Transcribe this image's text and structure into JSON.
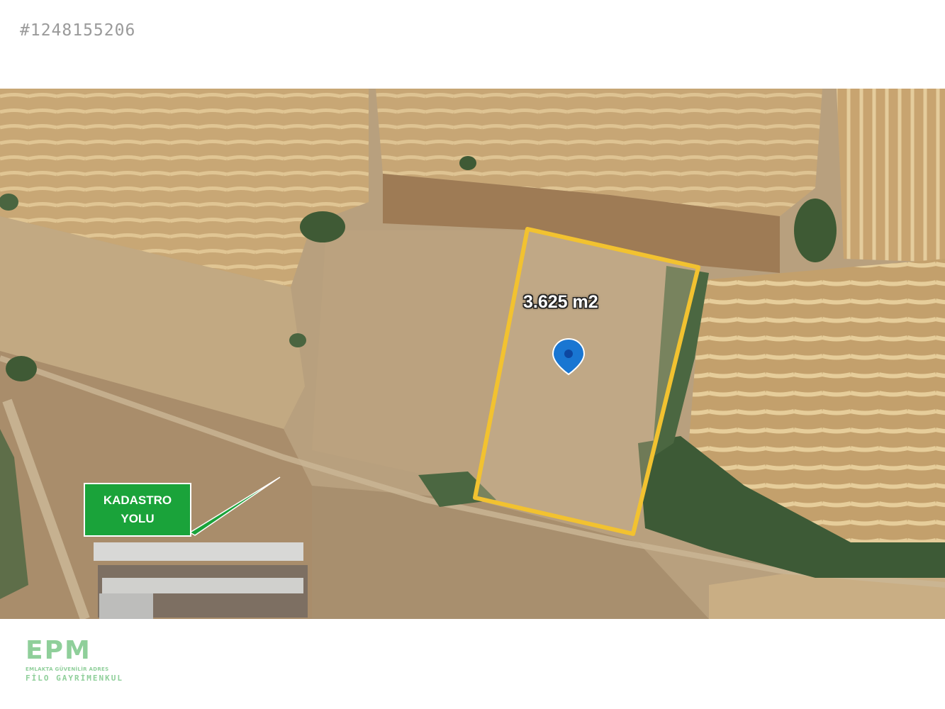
{
  "listing": {
    "id": "#1248155206"
  },
  "map": {
    "parcel_area": "3.625 m2",
    "road_callout": {
      "line1": "KADASTRO",
      "line2": "YOLU"
    },
    "parcel_outline_color": "#f2c230",
    "marker_color": "#1976d2",
    "callout_color": "#1aa33a",
    "marker_icon": "location-pin-icon"
  },
  "brand": {
    "mark": "EPM",
    "tagline": "EMLAKTA GÜVENİLİR ADRES",
    "name": "FİLO GAYRİMENKUL"
  }
}
